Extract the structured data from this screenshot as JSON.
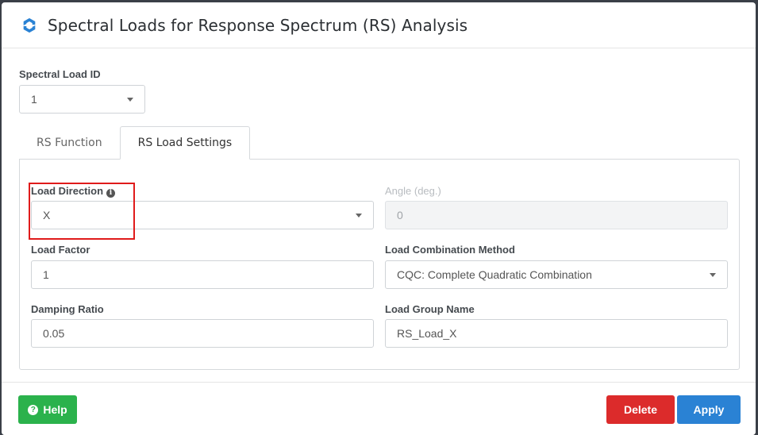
{
  "dialog": {
    "title": "Spectral Loads for Response Spectrum (RS) Analysis"
  },
  "spectral_load_id": {
    "label": "Spectral Load ID",
    "value": "1"
  },
  "tabs": [
    {
      "label": "RS Function",
      "active": false
    },
    {
      "label": "RS Load Settings",
      "active": true
    }
  ],
  "form": {
    "load_direction": {
      "label": "Load Direction",
      "value": "X",
      "info_icon": "info-icon"
    },
    "angle": {
      "label": "Angle (deg.)",
      "value": "0",
      "disabled": true
    },
    "load_factor": {
      "label": "Load Factor",
      "value": "1"
    },
    "combination_method": {
      "label": "Load Combination Method",
      "value": "CQC: Complete Quadratic Combination"
    },
    "damping_ratio": {
      "label": "Damping Ratio",
      "value": "0.05"
    },
    "load_group_name": {
      "label": "Load Group Name",
      "value": "RS_Load_X"
    }
  },
  "footer": {
    "help_label": "Help",
    "help_icon": "?",
    "delete_label": "Delete",
    "apply_label": "Apply"
  },
  "colors": {
    "help": "#2bb24c",
    "delete": "#dc2b2b",
    "apply": "#2a82d4",
    "highlight": "#e01b1b",
    "logo": "#2a82d4"
  }
}
